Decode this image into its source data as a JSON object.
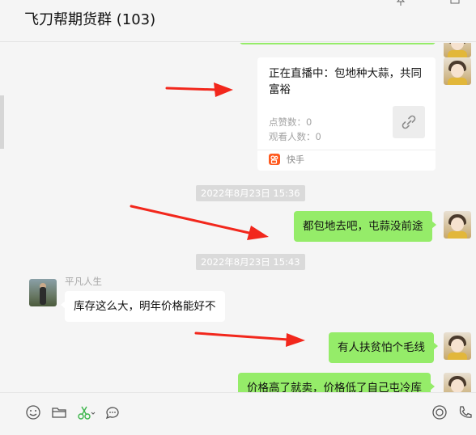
{
  "header": {
    "title": "飞刀帮期货群 (103)"
  },
  "messages": {
    "card": {
      "title": "正在直播中：包地种大蒜，共同富裕",
      "likes": "点赞数：0",
      "views": "观看人数：0",
      "source": "快手",
      "link_icon": "link-icon",
      "source_logo": "kuaishou-logo"
    },
    "timestamp_1": "2022年8月23日 15:36",
    "msg_1": "都包地去吧，屯蒜没前途",
    "timestamp_2": "2022年8月23日 15:43",
    "sender_name": "平凡人生",
    "msg_2": "库存这么大，明年价格能好不",
    "msg_3": "有人扶贫怕个毛线",
    "msg_4": "价格高了就卖，价格低了自己屯冷库"
  },
  "toolbar": {
    "icons": [
      "emoji-icon",
      "folder-icon",
      "scissors-icon",
      "chat-history-icon",
      "live-icon",
      "voice-call-icon"
    ]
  },
  "colors": {
    "bubble_self": "#95ec69",
    "bubble_other": "#ffffff",
    "background": "#f5f5f5",
    "arrow": "#f2271c",
    "timestamp_bg": "#dadada"
  }
}
